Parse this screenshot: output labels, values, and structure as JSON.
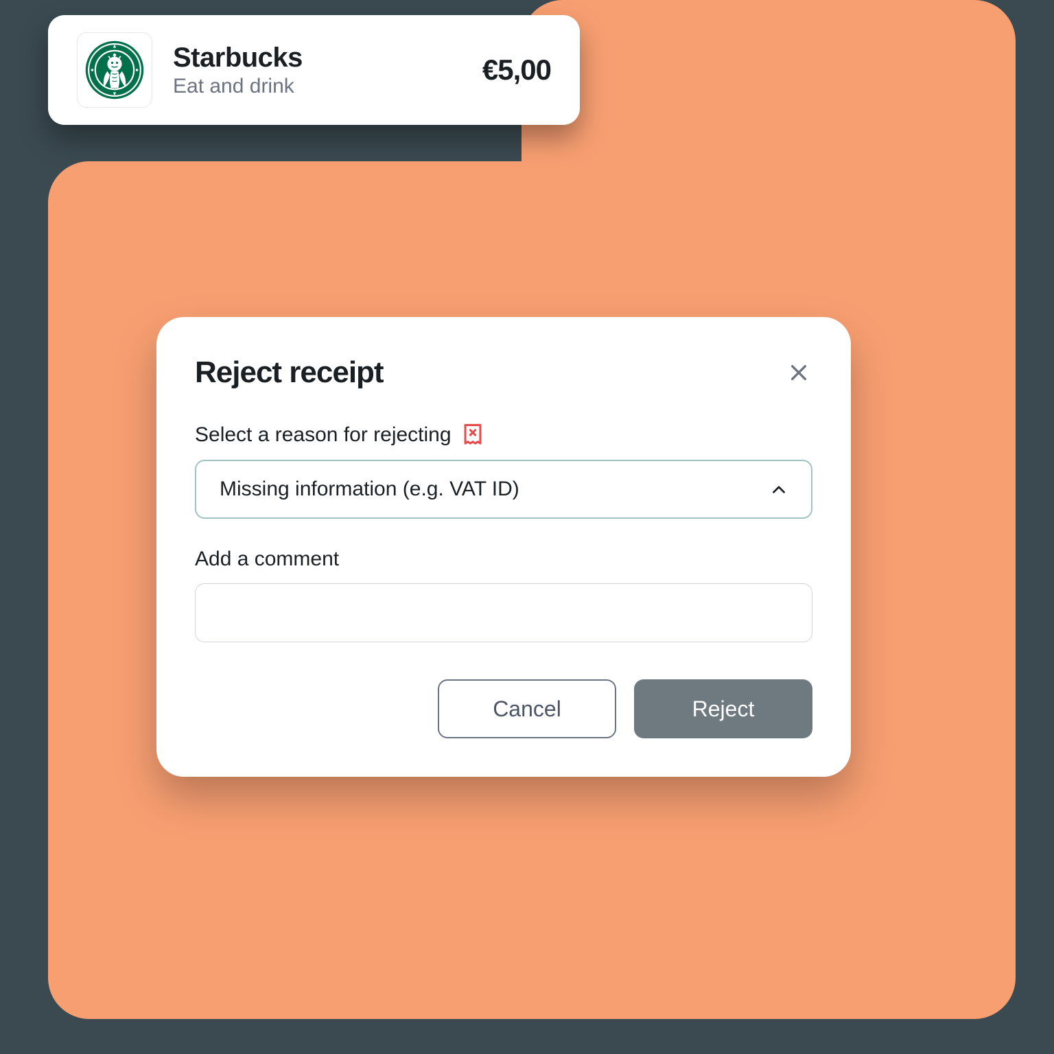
{
  "transaction": {
    "merchant_name": "Starbucks",
    "category": "Eat and drink",
    "amount": "€5,00",
    "logo_colors": {
      "brand": "#00704a"
    }
  },
  "dialog": {
    "title": "Reject receipt",
    "reason_label": "Select a reason for rejecting",
    "reason_selected": "Missing information (e.g. VAT ID)",
    "comment_label": "Add a comment",
    "comment_value": "",
    "cancel_label": "Cancel",
    "reject_label": "Reject",
    "icon_color": "#e84b4b"
  }
}
